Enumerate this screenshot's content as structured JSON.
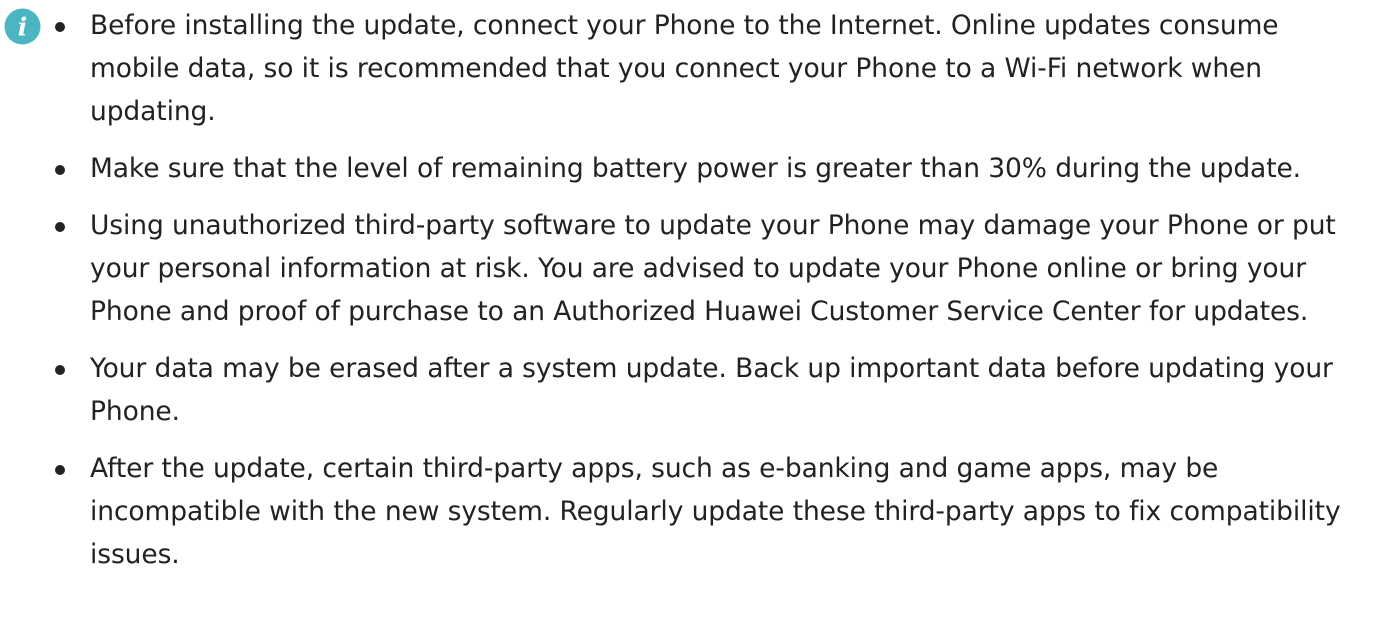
{
  "icon": {
    "name": "info-icon",
    "color": "#4bb5c1",
    "glyph": "i"
  },
  "notes": [
    "Before installing the update, connect your Phone to the Internet. Online updates consume mobile data, so it is recommended that you connect your Phone to a Wi-Fi network when updating.",
    "Make sure that the level of remaining battery power is greater than 30% during the update.",
    "Using unauthorized third-party software to update your Phone may damage your Phone or put your personal information at risk. You are advised to update your Phone online or bring your Phone and proof of purchase to an Authorized Huawei Customer Service Center for updates.",
    "Your data may be erased after a system update. Back up important data before updating your Phone.",
    "After the update, certain third-party apps, such as e-banking and game apps, may be incompatible with the new system. Regularly update these third-party apps to fix compatibility issues."
  ]
}
